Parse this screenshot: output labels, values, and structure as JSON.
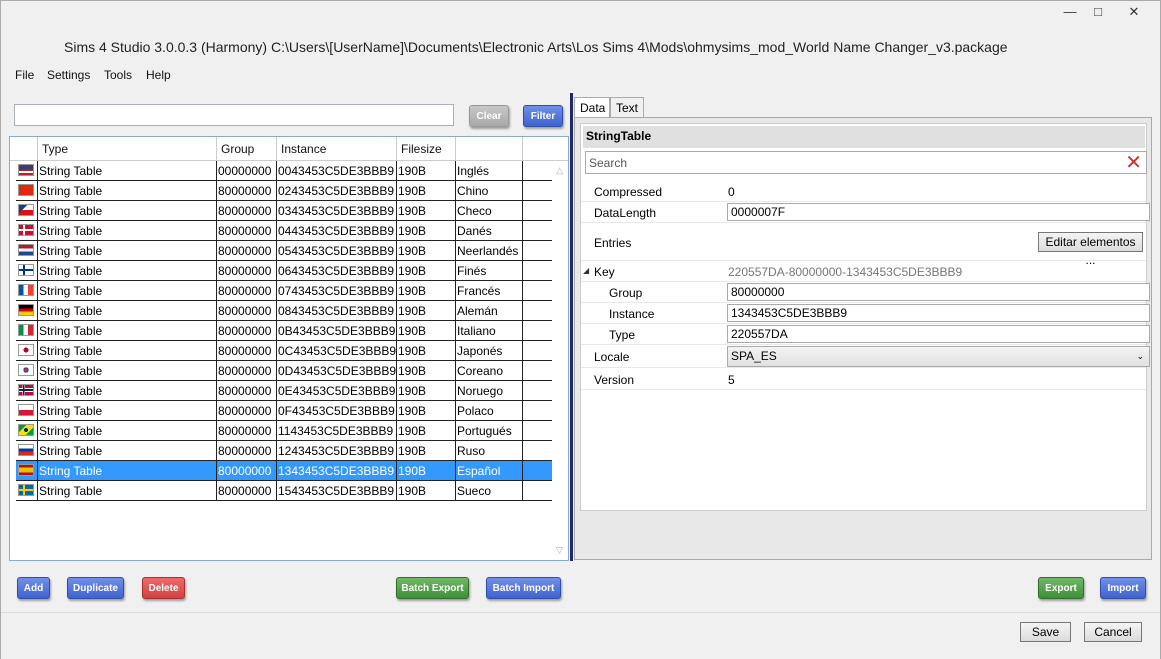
{
  "window": {
    "title": "Sims 4 Studio 3.0.0.3 (Harmony)  C:\\Users\\[UserName]\\Documents\\Electronic Arts\\Los Sims 4\\Mods\\ohmysims_mod_World Name Changer_v3.package",
    "minimize": "—",
    "maximize": "□",
    "close": "✕"
  },
  "menu": [
    "File",
    "Settings",
    "Tools",
    "Help"
  ],
  "filter": {
    "value": "",
    "clear_label": "Clear",
    "filter_label": "Filter"
  },
  "grid": {
    "columns": [
      "",
      "Type",
      "Group",
      "Instance",
      "Filesize",
      ""
    ],
    "rows": [
      {
        "flag": "us",
        "type": "String Table",
        "group": "00000000",
        "instance": "0043453C5DE3BBB9",
        "filesize": "190B",
        "lang": "Inglés",
        "selected": false
      },
      {
        "flag": "cn",
        "type": "String Table",
        "group": "80000000",
        "instance": "0243453C5DE3BBB9",
        "filesize": "190B",
        "lang": "Chino",
        "selected": false
      },
      {
        "flag": "cz",
        "type": "String Table",
        "group": "80000000",
        "instance": "0343453C5DE3BBB9",
        "filesize": "190B",
        "lang": "Checo",
        "selected": false
      },
      {
        "flag": "dk",
        "type": "String Table",
        "group": "80000000",
        "instance": "0443453C5DE3BBB9",
        "filesize": "190B",
        "lang": "Danés",
        "selected": false
      },
      {
        "flag": "nl",
        "type": "String Table",
        "group": "80000000",
        "instance": "0543453C5DE3BBB9",
        "filesize": "190B",
        "lang": "Neerlandés",
        "selected": false
      },
      {
        "flag": "fi",
        "type": "String Table",
        "group": "80000000",
        "instance": "0643453C5DE3BBB9",
        "filesize": "190B",
        "lang": "Finés",
        "selected": false
      },
      {
        "flag": "fr",
        "type": "String Table",
        "group": "80000000",
        "instance": "0743453C5DE3BBB9",
        "filesize": "190B",
        "lang": "Francés",
        "selected": false
      },
      {
        "flag": "de",
        "type": "String Table",
        "group": "80000000",
        "instance": "0843453C5DE3BBB9",
        "filesize": "190B",
        "lang": "Alemán",
        "selected": false
      },
      {
        "flag": "it",
        "type": "String Table",
        "group": "80000000",
        "instance": "0B43453C5DE3BBB9",
        "filesize": "190B",
        "lang": "Italiano",
        "selected": false
      },
      {
        "flag": "jp",
        "type": "String Table",
        "group": "80000000",
        "instance": "0C43453C5DE3BBB9",
        "filesize": "190B",
        "lang": "Japonés",
        "selected": false
      },
      {
        "flag": "kr",
        "type": "String Table",
        "group": "80000000",
        "instance": "0D43453C5DE3BBB9",
        "filesize": "190B",
        "lang": "Coreano",
        "selected": false
      },
      {
        "flag": "no",
        "type": "String Table",
        "group": "80000000",
        "instance": "0E43453C5DE3BBB9",
        "filesize": "190B",
        "lang": "Noruego",
        "selected": false
      },
      {
        "flag": "pl",
        "type": "String Table",
        "group": "80000000",
        "instance": "0F43453C5DE3BBB9",
        "filesize": "190B",
        "lang": "Polaco",
        "selected": false
      },
      {
        "flag": "br",
        "type": "String Table",
        "group": "80000000",
        "instance": "1143453C5DE3BBB9",
        "filesize": "190B",
        "lang": "Portugués",
        "selected": false
      },
      {
        "flag": "ru",
        "type": "String Table",
        "group": "80000000",
        "instance": "1243453C5DE3BBB9",
        "filesize": "190B",
        "lang": "Ruso",
        "selected": false
      },
      {
        "flag": "es",
        "type": "String Table",
        "group": "80000000",
        "instance": "1343453C5DE3BBB9",
        "filesize": "190B",
        "lang": "Español",
        "selected": true
      },
      {
        "flag": "se",
        "type": "String Table",
        "group": "80000000",
        "instance": "1543453C5DE3BBB9",
        "filesize": "190B",
        "lang": "Sueco",
        "selected": false
      }
    ]
  },
  "left_actions": {
    "add": "Add",
    "duplicate": "Duplicate",
    "delete": "Delete",
    "batch_export": "Batch Export",
    "batch_import": "Batch Import"
  },
  "right_actions": {
    "export": "Export",
    "import": "Import"
  },
  "tabs": [
    "Data",
    "Text"
  ],
  "props": {
    "title": "StringTable",
    "search_placeholder": "Search",
    "compressed_label": "Compressed",
    "compressed_value": "0",
    "datalength_label": "DataLength",
    "datalength_value": "0000007F",
    "entries_label": "Entries",
    "entries_button": "Editar elementos ...",
    "key_label": "Key",
    "key_value": "220557DA-80000000-1343453C5DE3BBB9",
    "group_label": "Group",
    "group_value": "80000000",
    "instance_label": "Instance",
    "instance_value": "1343453C5DE3BBB9",
    "type_label": "Type",
    "type_value": "220557DA",
    "locale_label": "Locale",
    "locale_value": "SPA_ES",
    "version_label": "Version",
    "version_value": "5"
  },
  "footer": {
    "save": "Save",
    "cancel": "Cancel"
  },
  "colors": {
    "accent_blue": "#3f63d0",
    "delete_red": "#d24242",
    "export_green": "#3f8f38",
    "selection": "#3399ff"
  }
}
